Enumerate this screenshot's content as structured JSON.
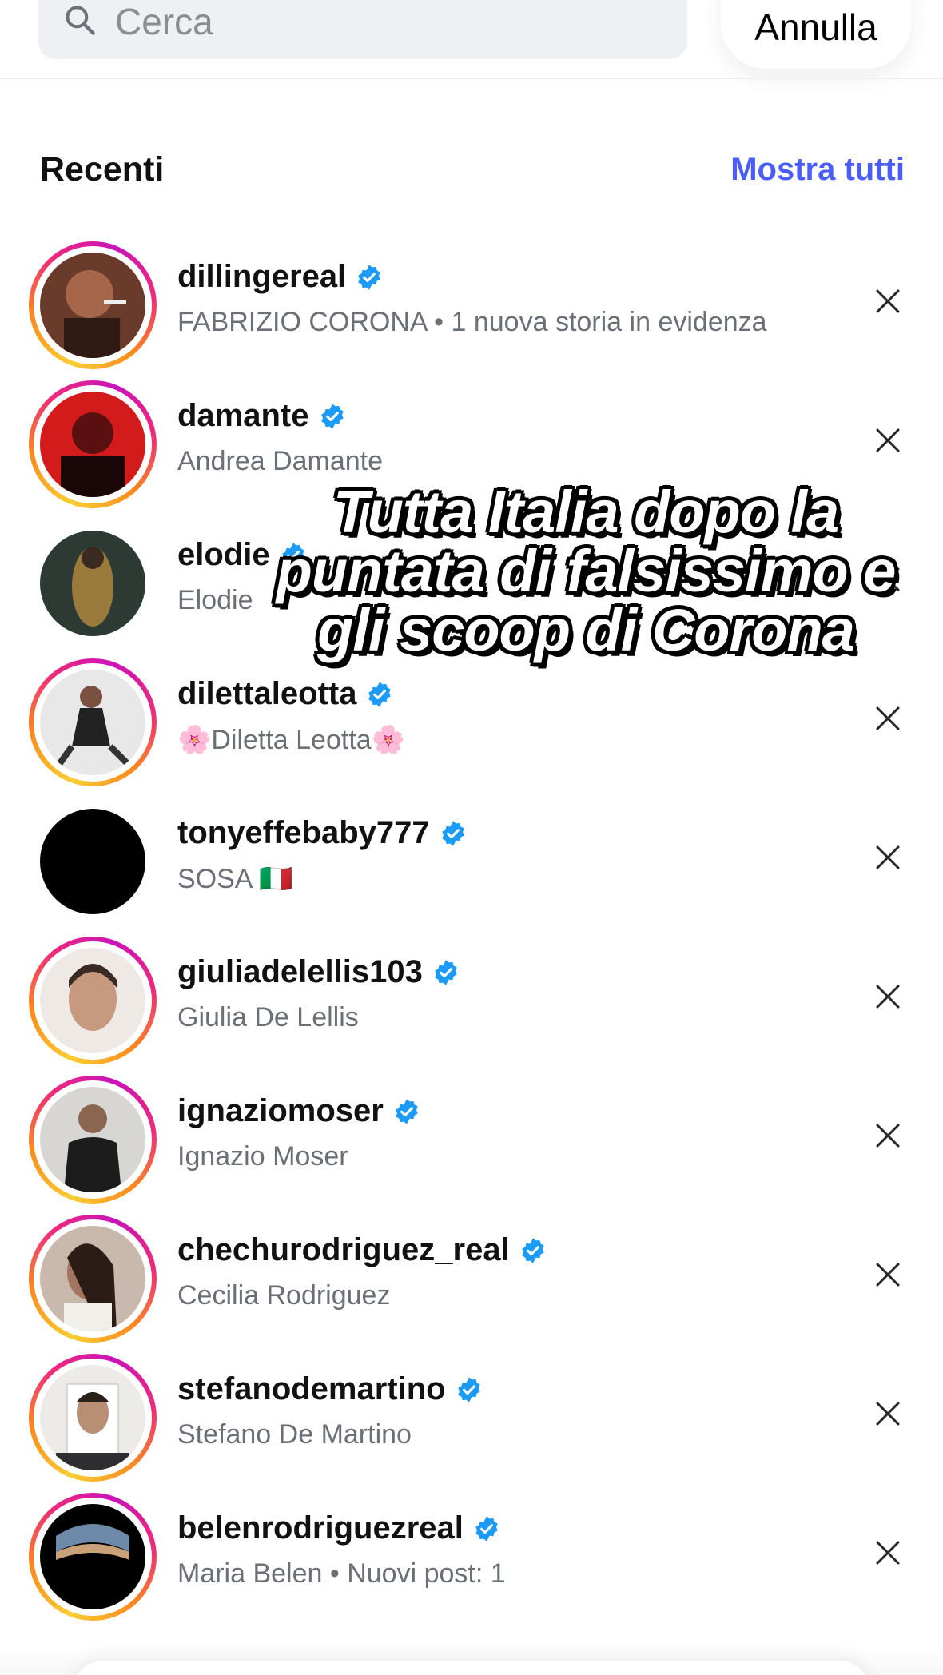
{
  "search": {
    "placeholder": "Cerca",
    "cancel_label": "Annulla"
  },
  "recent": {
    "title": "Recenti",
    "show_all_label": "Mostra tutti"
  },
  "accent_color": "#4a5df9",
  "verified_color": "#1b9af7",
  "caption": {
    "lines": [
      "Tutta Italia dopo la",
      "puntata di falsissimo e",
      "gli scoop di Corona"
    ]
  },
  "items": [
    {
      "username": "dillingereal",
      "subtitle": "FABRIZIO CORONA • 1 nuova storia in evidenza",
      "verified": true,
      "story_ring": true
    },
    {
      "username": "damante",
      "subtitle": "Andrea Damante",
      "verified": true,
      "story_ring": true
    },
    {
      "username": "elodie",
      "subtitle": "Elodie",
      "verified": true,
      "story_ring": false
    },
    {
      "username": "dilettaleotta",
      "subtitle": "🌸Diletta Leotta🌸",
      "verified": true,
      "story_ring": true
    },
    {
      "username": "tonyeffebaby777",
      "subtitle": "SOSA 🇮🇹",
      "verified": true,
      "story_ring": false
    },
    {
      "username": "giuliadelellis103",
      "subtitle": "Giulia De Lellis",
      "verified": true,
      "story_ring": true
    },
    {
      "username": "ignaziomoser",
      "subtitle": "Ignazio Moser",
      "verified": true,
      "story_ring": true
    },
    {
      "username": "chechurodriguez_real",
      "subtitle": "Cecilia Rodriguez",
      "verified": true,
      "story_ring": true
    },
    {
      "username": "stefanodemartino",
      "subtitle": "Stefano De Martino",
      "verified": true,
      "story_ring": true
    },
    {
      "username": "belenrodriguezreal",
      "subtitle": "Maria Belen • Nuovi post: 1",
      "verified": true,
      "story_ring": true
    }
  ]
}
